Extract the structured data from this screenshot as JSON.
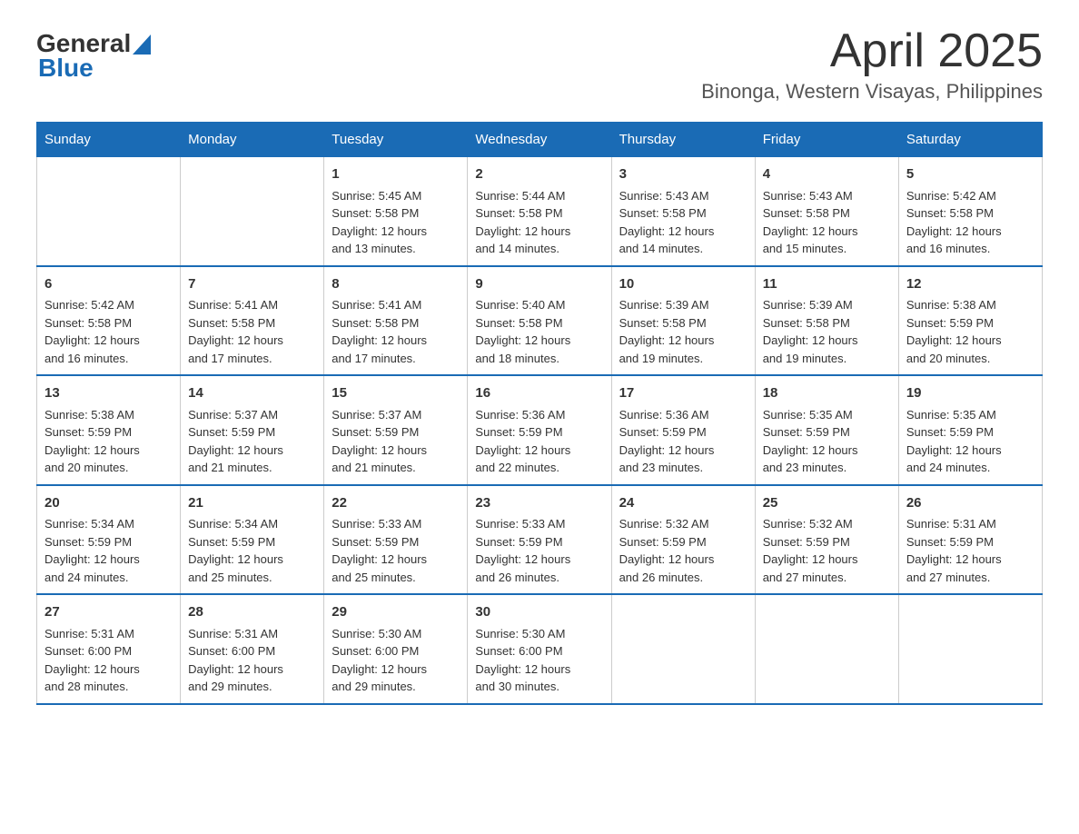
{
  "logo": {
    "text_general": "General",
    "text_blue": "Blue"
  },
  "header": {
    "title": "April 2025",
    "subtitle": "Binonga, Western Visayas, Philippines"
  },
  "columns": [
    "Sunday",
    "Monday",
    "Tuesday",
    "Wednesday",
    "Thursday",
    "Friday",
    "Saturday"
  ],
  "weeks": [
    [
      {
        "day": "",
        "info": ""
      },
      {
        "day": "",
        "info": ""
      },
      {
        "day": "1",
        "info": "Sunrise: 5:45 AM\nSunset: 5:58 PM\nDaylight: 12 hours\nand 13 minutes."
      },
      {
        "day": "2",
        "info": "Sunrise: 5:44 AM\nSunset: 5:58 PM\nDaylight: 12 hours\nand 14 minutes."
      },
      {
        "day": "3",
        "info": "Sunrise: 5:43 AM\nSunset: 5:58 PM\nDaylight: 12 hours\nand 14 minutes."
      },
      {
        "day": "4",
        "info": "Sunrise: 5:43 AM\nSunset: 5:58 PM\nDaylight: 12 hours\nand 15 minutes."
      },
      {
        "day": "5",
        "info": "Sunrise: 5:42 AM\nSunset: 5:58 PM\nDaylight: 12 hours\nand 16 minutes."
      }
    ],
    [
      {
        "day": "6",
        "info": "Sunrise: 5:42 AM\nSunset: 5:58 PM\nDaylight: 12 hours\nand 16 minutes."
      },
      {
        "day": "7",
        "info": "Sunrise: 5:41 AM\nSunset: 5:58 PM\nDaylight: 12 hours\nand 17 minutes."
      },
      {
        "day": "8",
        "info": "Sunrise: 5:41 AM\nSunset: 5:58 PM\nDaylight: 12 hours\nand 17 minutes."
      },
      {
        "day": "9",
        "info": "Sunrise: 5:40 AM\nSunset: 5:58 PM\nDaylight: 12 hours\nand 18 minutes."
      },
      {
        "day": "10",
        "info": "Sunrise: 5:39 AM\nSunset: 5:58 PM\nDaylight: 12 hours\nand 19 minutes."
      },
      {
        "day": "11",
        "info": "Sunrise: 5:39 AM\nSunset: 5:58 PM\nDaylight: 12 hours\nand 19 minutes."
      },
      {
        "day": "12",
        "info": "Sunrise: 5:38 AM\nSunset: 5:59 PM\nDaylight: 12 hours\nand 20 minutes."
      }
    ],
    [
      {
        "day": "13",
        "info": "Sunrise: 5:38 AM\nSunset: 5:59 PM\nDaylight: 12 hours\nand 20 minutes."
      },
      {
        "day": "14",
        "info": "Sunrise: 5:37 AM\nSunset: 5:59 PM\nDaylight: 12 hours\nand 21 minutes."
      },
      {
        "day": "15",
        "info": "Sunrise: 5:37 AM\nSunset: 5:59 PM\nDaylight: 12 hours\nand 21 minutes."
      },
      {
        "day": "16",
        "info": "Sunrise: 5:36 AM\nSunset: 5:59 PM\nDaylight: 12 hours\nand 22 minutes."
      },
      {
        "day": "17",
        "info": "Sunrise: 5:36 AM\nSunset: 5:59 PM\nDaylight: 12 hours\nand 23 minutes."
      },
      {
        "day": "18",
        "info": "Sunrise: 5:35 AM\nSunset: 5:59 PM\nDaylight: 12 hours\nand 23 minutes."
      },
      {
        "day": "19",
        "info": "Sunrise: 5:35 AM\nSunset: 5:59 PM\nDaylight: 12 hours\nand 24 minutes."
      }
    ],
    [
      {
        "day": "20",
        "info": "Sunrise: 5:34 AM\nSunset: 5:59 PM\nDaylight: 12 hours\nand 24 minutes."
      },
      {
        "day": "21",
        "info": "Sunrise: 5:34 AM\nSunset: 5:59 PM\nDaylight: 12 hours\nand 25 minutes."
      },
      {
        "day": "22",
        "info": "Sunrise: 5:33 AM\nSunset: 5:59 PM\nDaylight: 12 hours\nand 25 minutes."
      },
      {
        "day": "23",
        "info": "Sunrise: 5:33 AM\nSunset: 5:59 PM\nDaylight: 12 hours\nand 26 minutes."
      },
      {
        "day": "24",
        "info": "Sunrise: 5:32 AM\nSunset: 5:59 PM\nDaylight: 12 hours\nand 26 minutes."
      },
      {
        "day": "25",
        "info": "Sunrise: 5:32 AM\nSunset: 5:59 PM\nDaylight: 12 hours\nand 27 minutes."
      },
      {
        "day": "26",
        "info": "Sunrise: 5:31 AM\nSunset: 5:59 PM\nDaylight: 12 hours\nand 27 minutes."
      }
    ],
    [
      {
        "day": "27",
        "info": "Sunrise: 5:31 AM\nSunset: 6:00 PM\nDaylight: 12 hours\nand 28 minutes."
      },
      {
        "day": "28",
        "info": "Sunrise: 5:31 AM\nSunset: 6:00 PM\nDaylight: 12 hours\nand 29 minutes."
      },
      {
        "day": "29",
        "info": "Sunrise: 5:30 AM\nSunset: 6:00 PM\nDaylight: 12 hours\nand 29 minutes."
      },
      {
        "day": "30",
        "info": "Sunrise: 5:30 AM\nSunset: 6:00 PM\nDaylight: 12 hours\nand 30 minutes."
      },
      {
        "day": "",
        "info": ""
      },
      {
        "day": "",
        "info": ""
      },
      {
        "day": "",
        "info": ""
      }
    ]
  ]
}
